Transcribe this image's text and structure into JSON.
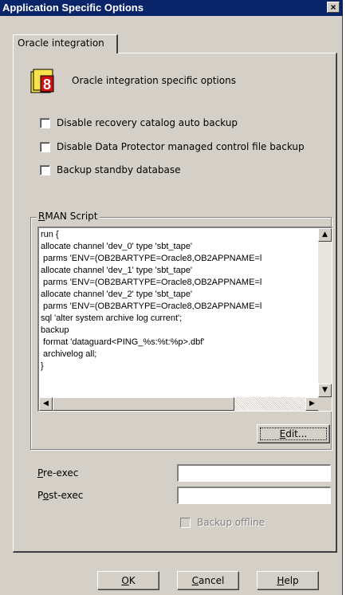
{
  "window": {
    "title": "Application Specific Options",
    "close_glyph": "×"
  },
  "tab": {
    "label": "Oracle integration"
  },
  "header": {
    "icon": "oracle-8-icon",
    "icon_digit": "8",
    "text": "Oracle integration specific options"
  },
  "options": [
    {
      "label": "Disable recovery catalog auto backup",
      "checked": false
    },
    {
      "label": "Disable Data Protector managed control file backup",
      "checked": false
    },
    {
      "label": "Backup standby database",
      "checked": false
    }
  ],
  "rman": {
    "group_label_accel": "R",
    "group_label_rest": "MAN Script",
    "script": "run {\nallocate channel 'dev_0' type 'sbt_tape'\n parms 'ENV=(OB2BARTYPE=Oracle8,OB2APPNAME=l\nallocate channel 'dev_1' type 'sbt_tape'\n parms 'ENV=(OB2BARTYPE=Oracle8,OB2APPNAME=l\nallocate channel 'dev_2' type 'sbt_tape'\n parms 'ENV=(OB2BARTYPE=Oracle8,OB2APPNAME=l\nsql 'alter system archive log current';\nbackup\n format 'dataguard<PING_%s:%t:%p>.dbf'\n archivelog all;\n}",
    "edit_accel": "E",
    "edit_rest": "dit..."
  },
  "fields": {
    "pre_exec_accel": "P",
    "pre_exec_rest": "re-exec",
    "pre_exec_value": "",
    "post_exec_pre": "P",
    "post_exec_accel": "o",
    "post_exec_rest": "st-exec",
    "post_exec_value": ""
  },
  "backup_offline": {
    "label": "Backup offline",
    "checked": false,
    "enabled": false
  },
  "buttons": {
    "ok_accel": "O",
    "ok_rest": "K",
    "cancel_accel": "C",
    "cancel_rest": "ancel",
    "help_accel": "H",
    "help_rest": "elp"
  },
  "colors": {
    "titlebar": "#0a246a",
    "face": "#d4d0c8",
    "icon_yellow": "#f7e34a",
    "icon_red": "#d01010"
  }
}
